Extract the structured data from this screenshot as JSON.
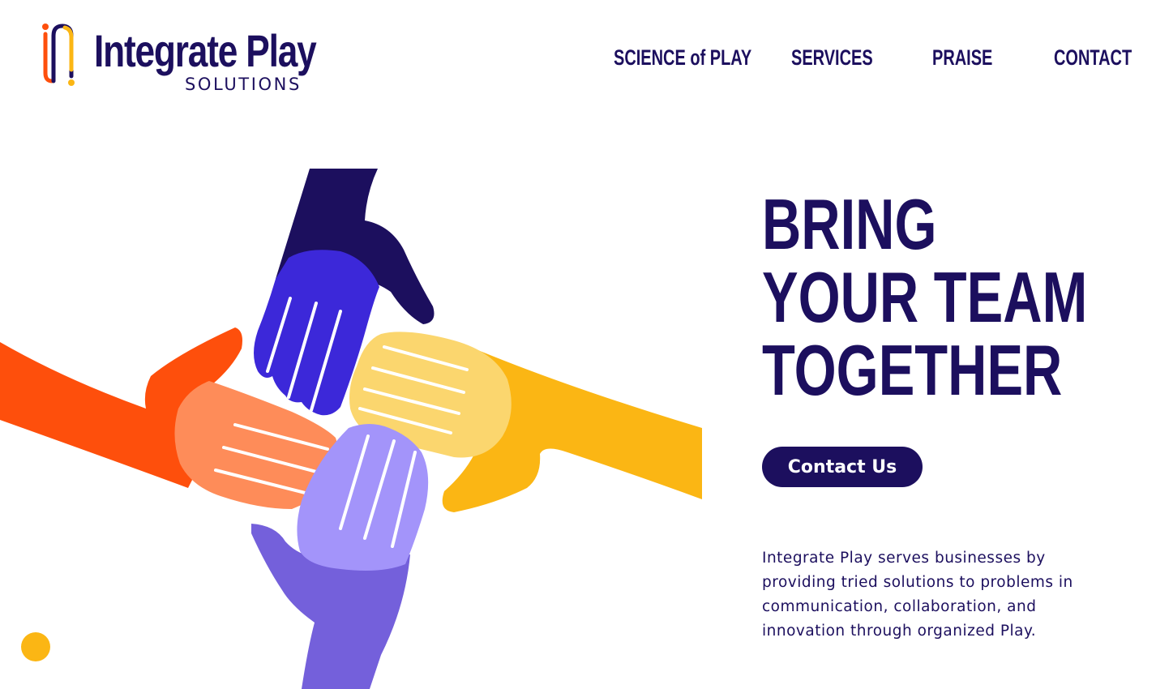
{
  "brand": {
    "name": "Integrate Play",
    "subtitle": "SOLUTIONS",
    "colors": {
      "navy": "#1c0f5e",
      "orange": "#fe4f0c",
      "yellow": "#fbb614",
      "indigo": "#3c28d9",
      "lavender": "#a394fa"
    }
  },
  "nav": {
    "items": [
      {
        "label": "SCIENCE of PLAY"
      },
      {
        "label": "SERVICES"
      },
      {
        "label": "PRAISE"
      },
      {
        "label": "CONTACT"
      }
    ]
  },
  "hero": {
    "headline_lines": [
      "BRING",
      "YOUR TEAM",
      "TOGETHER"
    ],
    "cta_label": "Contact Us",
    "description": "Integrate Play serves businesses by providing tried solutions to problems in communication, collaboration, and innovation through organized Play."
  },
  "icons": {
    "logo_mark": "ip-monogram-icon",
    "illustration": "team-hands-illustration",
    "decor_dot": "yellow-dot-icon"
  }
}
